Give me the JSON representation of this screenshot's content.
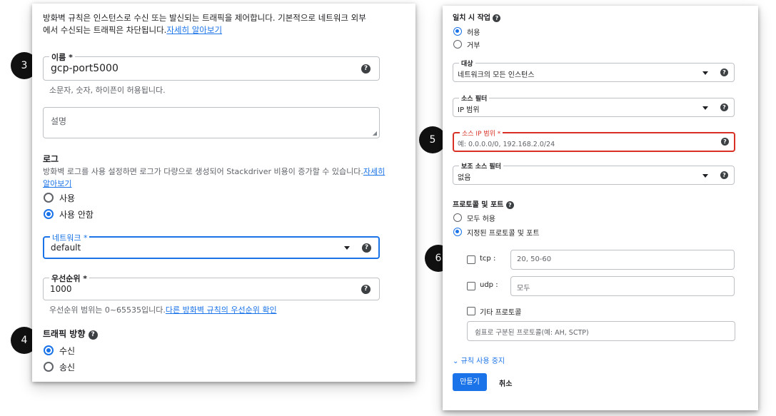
{
  "badges": [
    "3",
    "4",
    "5",
    "6"
  ],
  "left": {
    "intro_line1": "방화벽 규칙은 인스턴스로 수신 또는 발신되는 트래픽을 제어합니다. 기본적으로 네트워크 외부",
    "intro_line2": "에서 수신되는 트래픽은 차단됩니다.",
    "intro_link": "자세히 알아보기",
    "name_label": "이름 *",
    "name_value": "gcp-port5000",
    "name_hint": "소문자, 숫자, 하이픈이 허용됩니다.",
    "description_placeholder": "설명",
    "log_heading": "로그",
    "log_desc": "방화벽 로그를 사용 설정하면 로그가 다량으로 생성되어 Stackdriver 비용이 증가할 수 있습니다.",
    "log_link_part1": "자세히",
    "log_link_part2": "알아보기",
    "log_on": "사용",
    "log_off": "사용 안함",
    "network_label": "네트워크 *",
    "network_value": "default",
    "priority_label": "우선순위 *",
    "priority_value": "1000",
    "priority_hint": "우선순위 범위는 0~65535입니다.",
    "priority_link": "다른 방화벽 규칙의 우선순위 확인",
    "direction_heading": "트래픽 방향",
    "direction_ingress": "수신",
    "direction_egress": "송신"
  },
  "right": {
    "action_heading": "일치 시 작업",
    "action_allow": "허용",
    "action_deny": "거부",
    "target_label": "대상",
    "target_value": "네트워크의 모든 인스턴스",
    "source_filter_label": "소스 필터",
    "source_filter_value": "IP 범위",
    "source_ip_label": "소스 IP 범위 *",
    "source_ip_placeholder": "예: 0.0.0.0/0, 192.168.2.0/24",
    "secondary_filter_label": "보조 소스 필터",
    "secondary_filter_value": "없음",
    "proto_heading": "프로토콜 및 포트",
    "proto_all": "모두 허용",
    "proto_specified": "지정된 프로토콜 및 포트",
    "tcp_label": "tcp :",
    "tcp_ports": "20, 50-60",
    "udp_label": "udp :",
    "udp_ports": "모두",
    "other_label": "기타 프로토콜",
    "other_placeholder": "쉼표로 구분된 프로토콜(예: AH, SCTP)",
    "disable_rule": "규칙 사용 중지",
    "create_button": "만들기",
    "cancel_button": "취소"
  },
  "colors": {
    "accent": "#1a73e8",
    "error": "#d93025"
  }
}
